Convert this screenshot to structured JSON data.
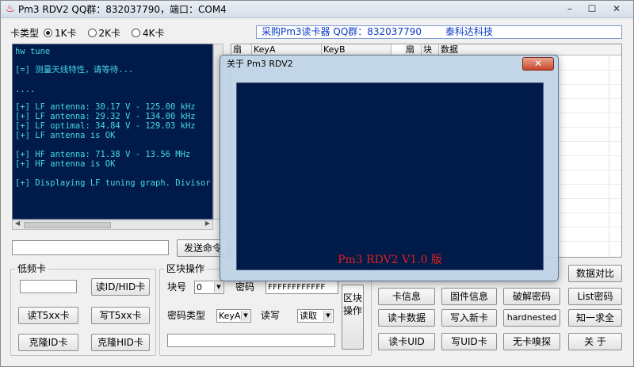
{
  "window": {
    "title": "Pm3 RDV2 QQ群：832037790，端口：COM4",
    "minimize_glyph": "–",
    "maximize_glyph": "☐",
    "close_glyph": "✕"
  },
  "card_type": {
    "label": "卡类型",
    "options": [
      "1K卡",
      "2K卡",
      "4K卡"
    ],
    "selected": "1K卡"
  },
  "banner": {
    "left": "采购Pm3读卡器 QQ群：832037790",
    "right": "泰科达科技"
  },
  "terminal": {
    "lines": [
      "hw tune",
      "[=] 测量天线特性，请等待...",
      "....",
      "[+] LF antenna: 30.17 V - 125.00 kHz",
      "[+] LF antenna: 29.32 V - 134.00 kHz",
      "[+] LF optimal: 34.84 V - 129.03 kHz",
      "[+] LF antenna is OK",
      "[+] HF antenna: 71.38 V - 13.56 MHz",
      "[+] HF antenna is OK",
      "[+] Displaying LF tuning graph. Divisor"
    ]
  },
  "grid": {
    "headers": [
      "扇",
      "KeyA",
      "KeyB",
      "扇",
      "块",
      "数据"
    ]
  },
  "command": {
    "send_label": "发送命令"
  },
  "low_freq": {
    "label": "低频卡",
    "read_id_hid": "读ID/HID卡",
    "read_t5xx": "读T5xx卡",
    "write_t5xx": "写T5xx卡",
    "clone_id": "克隆ID卡",
    "clone_hid": "克隆HID卡"
  },
  "block_ops": {
    "label": "区块操作",
    "block_no_label": "块号",
    "block_no_value": "0",
    "password_label": "密码",
    "password_value": "FFFFFFFFFFFF",
    "key_type_label": "密码类型",
    "key_type_value": "KeyA",
    "rw_label": "读写",
    "rw_value": "读取",
    "zone_ops_label": "区块操作"
  },
  "right_buttons": {
    "card_info": "卡信息",
    "firmware_info": "固件信息",
    "crack_password": "破解密码",
    "list_password": "List密码",
    "data_compare": "数据对比",
    "read_card_data": "读卡数据",
    "write_new_card": "写入新卡",
    "hardnested": "hardnested",
    "know_one_all": "知一求全",
    "read_uid": "读卡UID",
    "write_uid": "写UID卡",
    "no_card_sniff": "无卡嗅探",
    "about": "关  于"
  },
  "about_dialog": {
    "title": "关于 Pm3 RDV2",
    "version": "Pm3 RDV2 V1.0 版"
  }
}
